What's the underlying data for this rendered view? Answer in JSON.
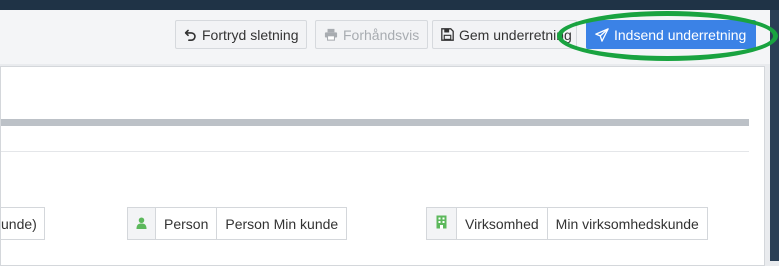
{
  "toolbar": {
    "undo_delete_label": "Fortryd sletning",
    "preview_label": "Forhåndsvis",
    "save_label": "Gem underretning",
    "submit_label": "Indsend underretning"
  },
  "form": {
    "partial_group": {
      "value": "unde)"
    },
    "person_group": {
      "type_label": "Person",
      "value": "Person Min kunde"
    },
    "company_group": {
      "type_label": "Virksomhed",
      "value": "Min virksomhedskunde"
    }
  },
  "colors": {
    "primary": "#3b82e6",
    "highlight_ring": "#19a340",
    "person_icon": "#5cb85c"
  },
  "icons": {
    "undo": "undo-icon",
    "preview": "print-icon",
    "save": "floppy-disk-icon",
    "submit": "paper-plane-icon",
    "person": "user-icon",
    "company": "building-icon"
  }
}
